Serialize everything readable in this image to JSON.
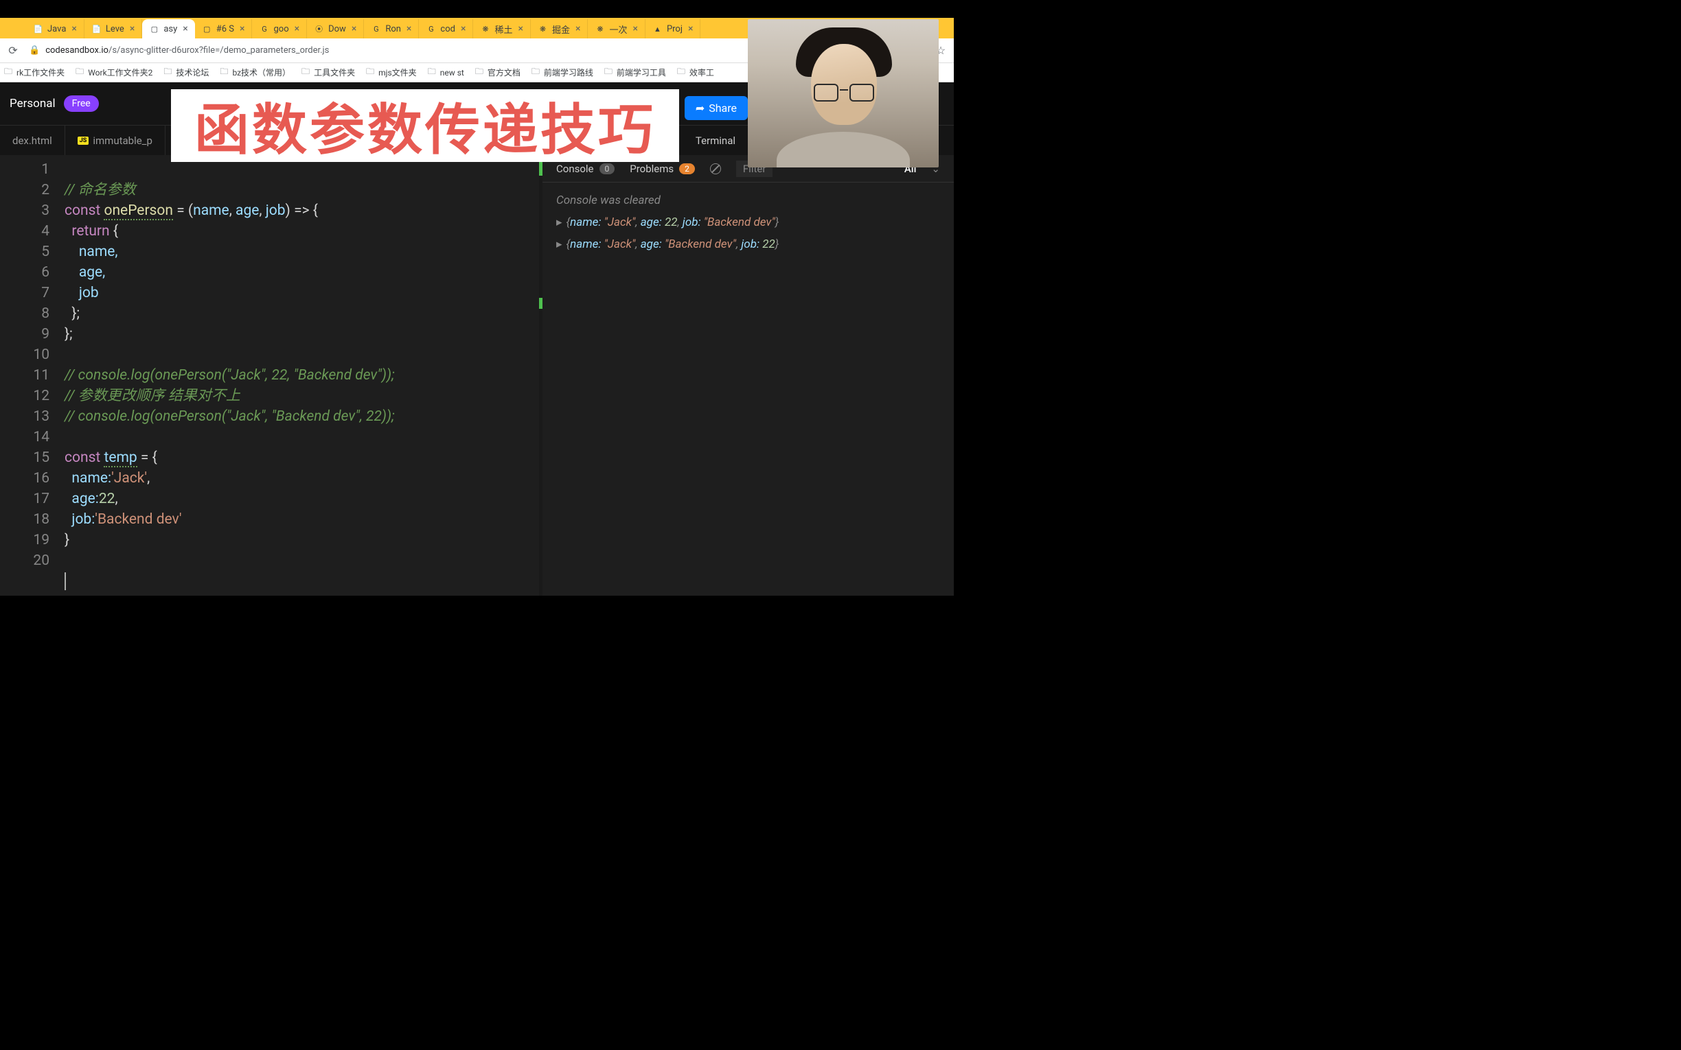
{
  "mac": {
    "red": "",
    "yellow": "",
    "green": ""
  },
  "browserTabs": [
    {
      "fav": "📄",
      "label": "Java",
      "active": false
    },
    {
      "fav": "📄",
      "label": "Leve",
      "active": false
    },
    {
      "fav": "▢",
      "label": "asy",
      "active": true
    },
    {
      "fav": "▢",
      "label": "#6 S",
      "active": false
    },
    {
      "fav": "G",
      "label": "goo",
      "active": false
    },
    {
      "fav": "⦿",
      "label": "Dow",
      "active": false
    },
    {
      "fav": "G",
      "label": "Ron",
      "active": false
    },
    {
      "fav": "G",
      "label": "cod",
      "active": false
    },
    {
      "fav": "❋",
      "label": "稀土",
      "active": false
    },
    {
      "fav": "❋",
      "label": "掘金",
      "active": false
    },
    {
      "fav": "❋",
      "label": "一次",
      "active": false
    },
    {
      "fav": "▲",
      "label": "Proj",
      "active": false
    }
  ],
  "url": {
    "host": "codesandbox.io",
    "path": "/s/async-glitter-d6urox?file=/demo_parameters_order.js"
  },
  "bookmarks": [
    "rk工作文件夹",
    "Work工作文件夹2",
    "技术论坛",
    "bz技术（常用）",
    "工具文件夹",
    "mjs文件夹",
    "new st",
    "官方文档",
    "前端学习路线",
    "前端学习工具",
    "效率工"
  ],
  "csb": {
    "personal": "Personal",
    "free": "Free",
    "share": "Share"
  },
  "overlayTitle": "函数参数传递技巧",
  "editorTabs": {
    "left": "dex.html",
    "second": "immutable_p",
    "terminal": "Terminal"
  },
  "code": {
    "l1": "// 命名参数",
    "l2a": "const ",
    "l2b": "onePerson",
    "l2c": " = (",
    "l2d": "name",
    "l2e": ", ",
    "l2f": "age",
    "l2g": ", ",
    "l2h": "job",
    "l2i": ") => {",
    "l3a": "  return ",
    "l3b": "{",
    "l4": "    name,",
    "l5": "    age,",
    "l6": "    job",
    "l7": "  };",
    "l8": "};",
    "l10": "// console.log(onePerson(\"Jack\", 22, \"Backend dev\"));",
    "l11": "// 参数更改顺序 结果对不上",
    "l12": "// console.log(onePerson(\"Jack\", \"Backend dev\", 22));",
    "l14a": "const ",
    "l14b": "temp",
    "l14c": " = {",
    "l15a": "  name:",
    "l15b": "'Jack'",
    "l15c": ",",
    "l16a": "  age:",
    "l16b": "22",
    "l16c": ",",
    "l17a": "  job:",
    "l17b": "'Backend dev'",
    "l18": "}"
  },
  "lineNumbers": [
    "1",
    "2",
    "3",
    "4",
    "5",
    "6",
    "7",
    "8",
    "9",
    "10",
    "11",
    "12",
    "13",
    "14",
    "15",
    "16",
    "17",
    "18",
    "19",
    "20"
  ],
  "console": {
    "tabConsole": "Console",
    "consoleCount": "0",
    "tabProblems": "Problems",
    "problemsCount": "2",
    "filter": "Filter",
    "all": "All",
    "cleared": "Console was cleared",
    "row1": {
      "open": "{",
      "name": "name: ",
      "nameV": "\"Jack\"",
      "c1": ", ",
      "age": "age: ",
      "ageV": "22",
      "c2": ", ",
      "job": "job: ",
      "jobV": "\"Backend dev\"",
      "close": "}"
    },
    "row2": {
      "open": "{",
      "name": "name: ",
      "nameV": "\"Jack\"",
      "c1": ", ",
      "age": "age: ",
      "ageV": "\"Backend dev\"",
      "c2": ", ",
      "job": "job: ",
      "jobV": "22",
      "close": "}"
    }
  }
}
